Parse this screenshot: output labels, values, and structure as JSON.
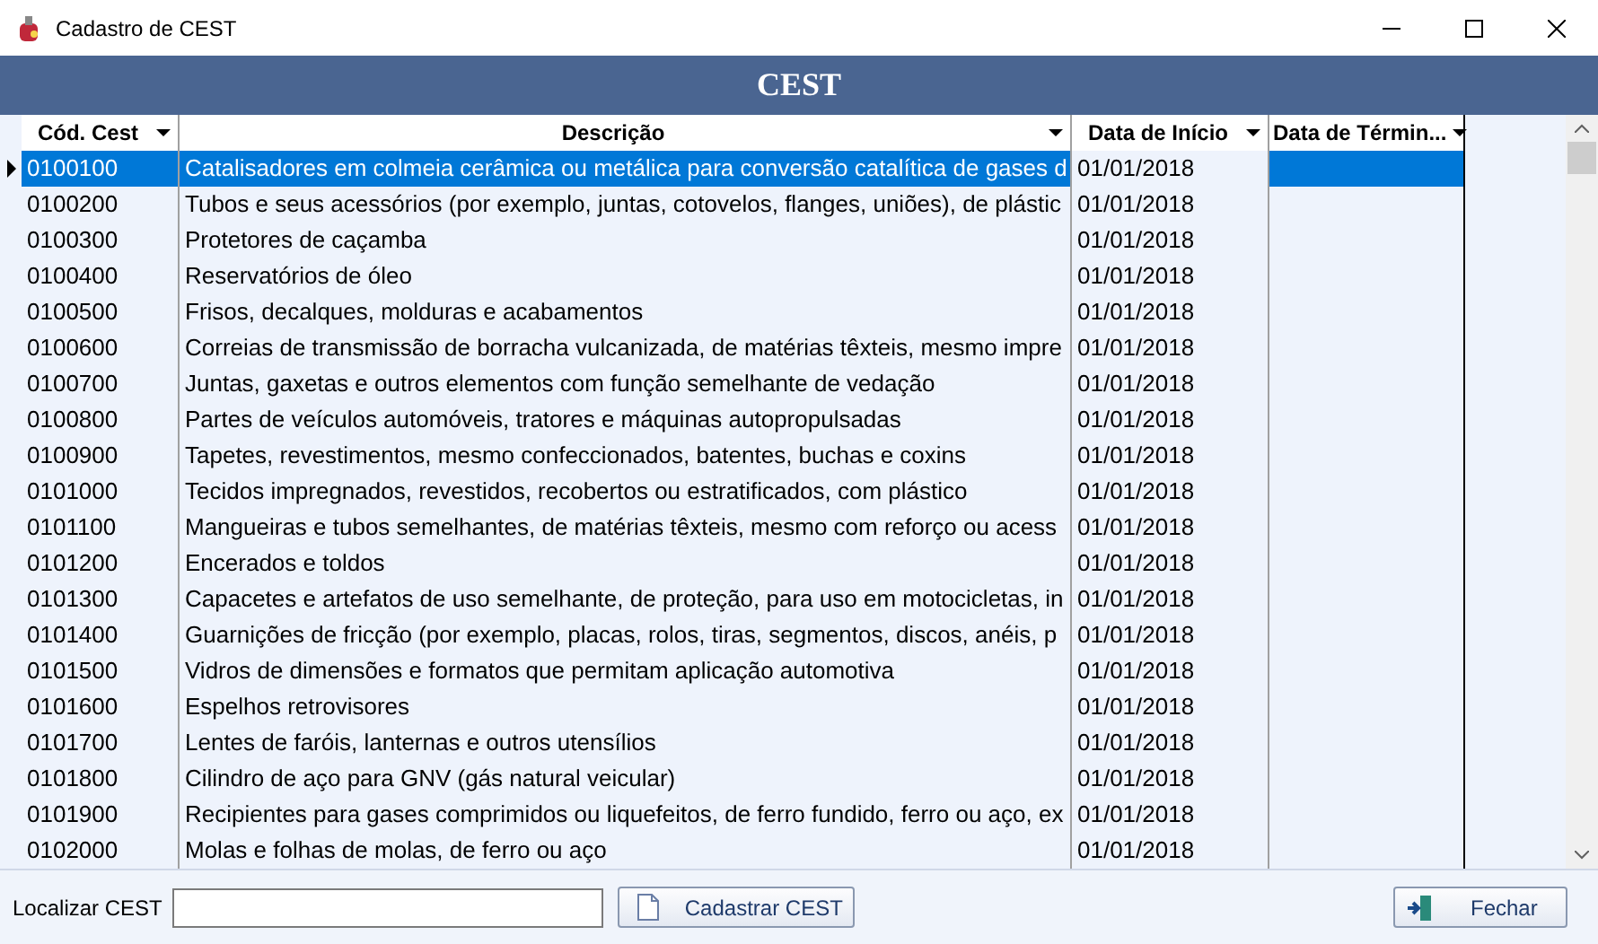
{
  "window": {
    "title": "Cadastro de CEST"
  },
  "header": {
    "title": "CEST"
  },
  "table": {
    "columns": [
      "Cód. Cest",
      "Descrição",
      "Data de Início",
      "Data de Términ..."
    ],
    "rows": [
      {
        "code": "0100100",
        "description": "Catalisadores em colmeia cerâmica ou metálica para conversão catalítica de gases d",
        "start": "01/01/2018",
        "selected": true
      },
      {
        "code": "0100200",
        "description": "Tubos e seus acessórios (por exemplo, juntas, cotovelos, flanges, uniões), de plástic",
        "start": "01/01/2018",
        "selected": false
      },
      {
        "code": "0100300",
        "description": "Protetores de caçamba",
        "start": "01/01/2018",
        "selected": false
      },
      {
        "code": "0100400",
        "description": "Reservatórios de óleo",
        "start": "01/01/2018",
        "selected": false
      },
      {
        "code": "0100500",
        "description": "Frisos, decalques, molduras e acabamentos",
        "start": "01/01/2018",
        "selected": false
      },
      {
        "code": "0100600",
        "description": "Correias de transmissão de borracha vulcanizada, de matérias têxteis, mesmo impre",
        "start": "01/01/2018",
        "selected": false
      },
      {
        "code": "0100700",
        "description": "Juntas, gaxetas e outros elementos com função semelhante de vedação",
        "start": "01/01/2018",
        "selected": false
      },
      {
        "code": "0100800",
        "description": "Partes de veículos automóveis, tratores e máquinas autopropulsadas",
        "start": "01/01/2018",
        "selected": false
      },
      {
        "code": "0100900",
        "description": "Tapetes, revestimentos, mesmo confeccionados, batentes, buchas e coxins",
        "start": "01/01/2018",
        "selected": false
      },
      {
        "code": "0101000",
        "description": "Tecidos impregnados, revestidos, recobertos ou estratificados, com plástico",
        "start": "01/01/2018",
        "selected": false
      },
      {
        "code": "0101100",
        "description": "Mangueiras e tubos semelhantes, de matérias têxteis, mesmo com reforço ou acess",
        "start": "01/01/2018",
        "selected": false
      },
      {
        "code": "0101200",
        "description": "Encerados e toldos",
        "start": "01/01/2018",
        "selected": false
      },
      {
        "code": "0101300",
        "description": "Capacetes e artefatos de uso semelhante, de proteção, para uso em motocicletas, in",
        "start": "01/01/2018",
        "selected": false
      },
      {
        "code": "0101400",
        "description": "Guarnições de fricção (por exemplo, placas, rolos, tiras, segmentos, discos, anéis, p",
        "start": "01/01/2018",
        "selected": false
      },
      {
        "code": "0101500",
        "description": "Vidros de dimensões e formatos que permitam aplicação automotiva",
        "start": "01/01/2018",
        "selected": false
      },
      {
        "code": "0101600",
        "description": "Espelhos retrovisores",
        "start": "01/01/2018",
        "selected": false
      },
      {
        "code": "0101700",
        "description": "Lentes de faróis, lanternas e outros utensílios",
        "start": "01/01/2018",
        "selected": false
      },
      {
        "code": "0101800",
        "description": "Cilindro de aço para GNV (gás natural veicular)",
        "start": "01/01/2018",
        "selected": false
      },
      {
        "code": "0101900",
        "description": "Recipientes para gases comprimidos ou liquefeitos, de ferro fundido, ferro ou aço, ex",
        "start": "01/01/2018",
        "selected": false
      },
      {
        "code": "0102000",
        "description": "Molas e folhas de molas, de ferro ou aço",
        "start": "01/01/2018",
        "selected": false
      }
    ]
  },
  "search": {
    "label": "Localizar CEST"
  },
  "buttons": {
    "register": "Cadastrar CEST",
    "close": "Fechar"
  }
}
